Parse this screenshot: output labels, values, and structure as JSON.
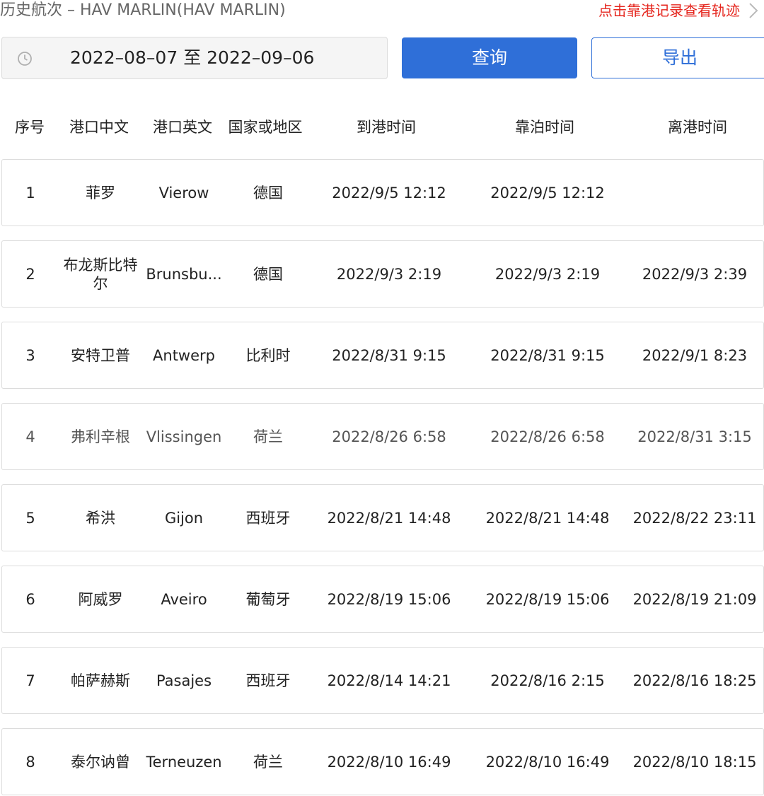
{
  "header": {
    "title": "历史航次 – HAV MARLIN(HAV MARLIN)",
    "track_link": "点击靠港记录查看轨迹"
  },
  "toolbar": {
    "date_range": "2022–08–07 至 2022–09–06",
    "query_label": "查询",
    "export_label": "导出"
  },
  "table": {
    "columns": [
      "序号",
      "港口中文",
      "港口英文",
      "国家或地区",
      "到港时间",
      "靠泊时间",
      "离港时间"
    ],
    "rows": [
      {
        "no": "1",
        "cn": "菲罗",
        "en": "Vierow",
        "country": "德国",
        "arrive": "2022/9/5 12:12",
        "berth": "2022/9/5 12:12",
        "depart": ""
      },
      {
        "no": "2",
        "cn": "布龙斯比特尔",
        "en": "Brunsbu...",
        "country": "德国",
        "arrive": "2022/9/3 2:19",
        "berth": "2022/9/3 2:19",
        "depart": "2022/9/3 2:39"
      },
      {
        "no": "3",
        "cn": "安特卫普",
        "en": "Antwerp",
        "country": "比利时",
        "arrive": "2022/8/31 9:15",
        "berth": "2022/8/31 9:15",
        "depart": "2022/9/1 8:23"
      },
      {
        "no": "4",
        "cn": "弗利辛根",
        "en": "Vlissingen",
        "country": "荷兰",
        "arrive": "2022/8/26 6:58",
        "berth": "2022/8/26 6:58",
        "depart": "2022/8/31 3:15"
      },
      {
        "no": "5",
        "cn": "希洪",
        "en": "Gijon",
        "country": "西班牙",
        "arrive": "2022/8/21 14:48",
        "berth": "2022/8/21 14:48",
        "depart": "2022/8/22 23:11"
      },
      {
        "no": "6",
        "cn": "阿威罗",
        "en": "Aveiro",
        "country": "葡萄牙",
        "arrive": "2022/8/19 15:06",
        "berth": "2022/8/19 15:06",
        "depart": "2022/8/19 21:09"
      },
      {
        "no": "7",
        "cn": "帕萨赫斯",
        "en": "Pasajes",
        "country": "西班牙",
        "arrive": "2022/8/14 14:21",
        "berth": "2022/8/16 2:15",
        "depart": "2022/8/16 18:25"
      },
      {
        "no": "8",
        "cn": "泰尔讷曾",
        "en": "Terneuzen",
        "country": "荷兰",
        "arrive": "2022/8/10 16:49",
        "berth": "2022/8/10 16:49",
        "depart": "2022/8/10 18:15"
      }
    ]
  },
  "icons": {
    "clock": "clock-icon",
    "chevron": "chevron-right-icon"
  },
  "colors": {
    "primary": "#2f6fd8",
    "link_red": "#e5251d"
  }
}
